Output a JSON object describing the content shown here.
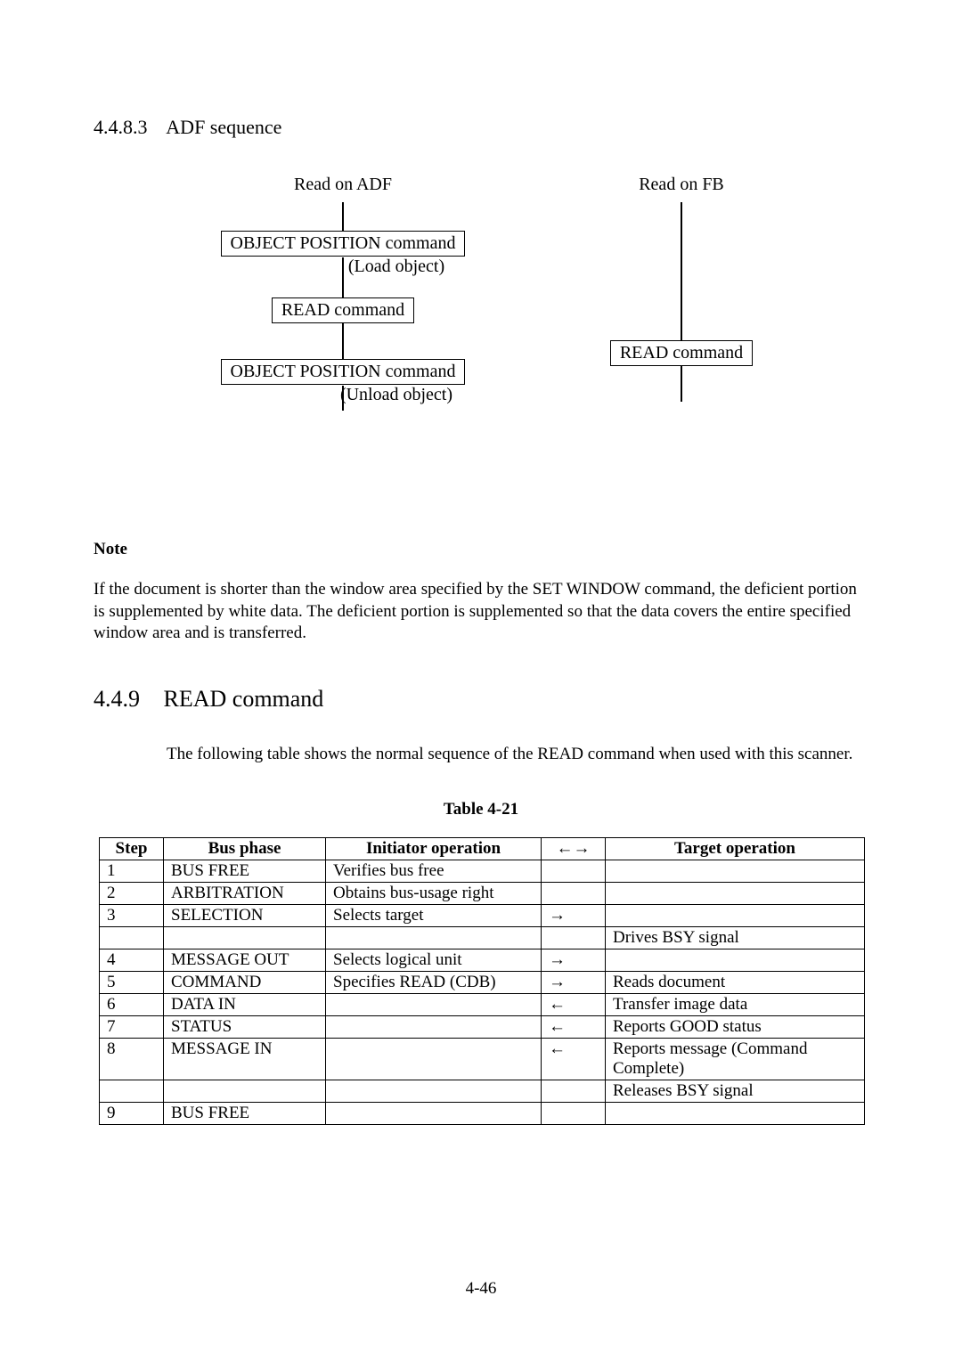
{
  "section": {
    "number_h3": "4.4.8.3",
    "title_h3": "ADF sequence",
    "number_h2": "4.4.9",
    "title_h2": "READ command"
  },
  "flow": {
    "adf_label": "Read on ADF",
    "fb_label": "Read on FB",
    "box1": "OBJECT POSITION command",
    "aside1": "(Load object)",
    "box2_adf": "READ command",
    "box2_fb": "READ command",
    "box3": "OBJECT POSITION command",
    "aside3": "(Unload object)"
  },
  "note": {
    "heading": "Note",
    "body": "If the document is shorter than the window area specified by the SET WINDOW command, the deficient portion is supplemented by white data. The deficient portion is supplemented so that the data covers the entire specified window area and is transferred."
  },
  "intro": "The following table shows the normal sequence of the READ command when used with this scanner.",
  "table": {
    "caption": "Table 4-21",
    "headers": {
      "step": "Step",
      "phase": "Bus phase",
      "initiator": "Initiator operation",
      "dir": "←→",
      "target": "Target operation"
    },
    "rows": [
      {
        "step": "1",
        "phase": "BUS FREE",
        "initiator": "Verifies bus free",
        "dir": "",
        "target": ""
      },
      {
        "step": "2",
        "phase": "ARBITRATION",
        "initiator": "Obtains bus-usage right",
        "dir": "",
        "target": ""
      },
      {
        "step": "3",
        "phase": "SELECTION",
        "initiator": "Selects target",
        "dir": "→",
        "target": ""
      },
      {
        "step": "",
        "phase": "",
        "initiator": "",
        "dir": "",
        "target": "Drives BSY signal"
      },
      {
        "step": "4",
        "phase": "MESSAGE OUT",
        "initiator": "Selects logical unit",
        "dir": "→",
        "target": ""
      },
      {
        "step": "5",
        "phase": "COMMAND",
        "initiator": "Specifies READ (CDB)",
        "dir": "→",
        "target": "Reads document"
      },
      {
        "step": "6",
        "phase": "DATA IN",
        "initiator": "",
        "dir": "←",
        "target": "Transfer image data"
      },
      {
        "step": "7",
        "phase": "STATUS",
        "initiator": "",
        "dir": "←",
        "target": "Reports GOOD status"
      },
      {
        "step": "8",
        "phase": "MESSAGE IN",
        "initiator": "",
        "dir": "←",
        "target": "Reports message (Command Complete)"
      },
      {
        "step": "",
        "phase": "",
        "initiator": "",
        "dir": "",
        "target": "Releases BSY signal"
      },
      {
        "step": "9",
        "phase": "BUS FREE",
        "initiator": "",
        "dir": "",
        "target": ""
      }
    ]
  },
  "page_number": "4-46"
}
